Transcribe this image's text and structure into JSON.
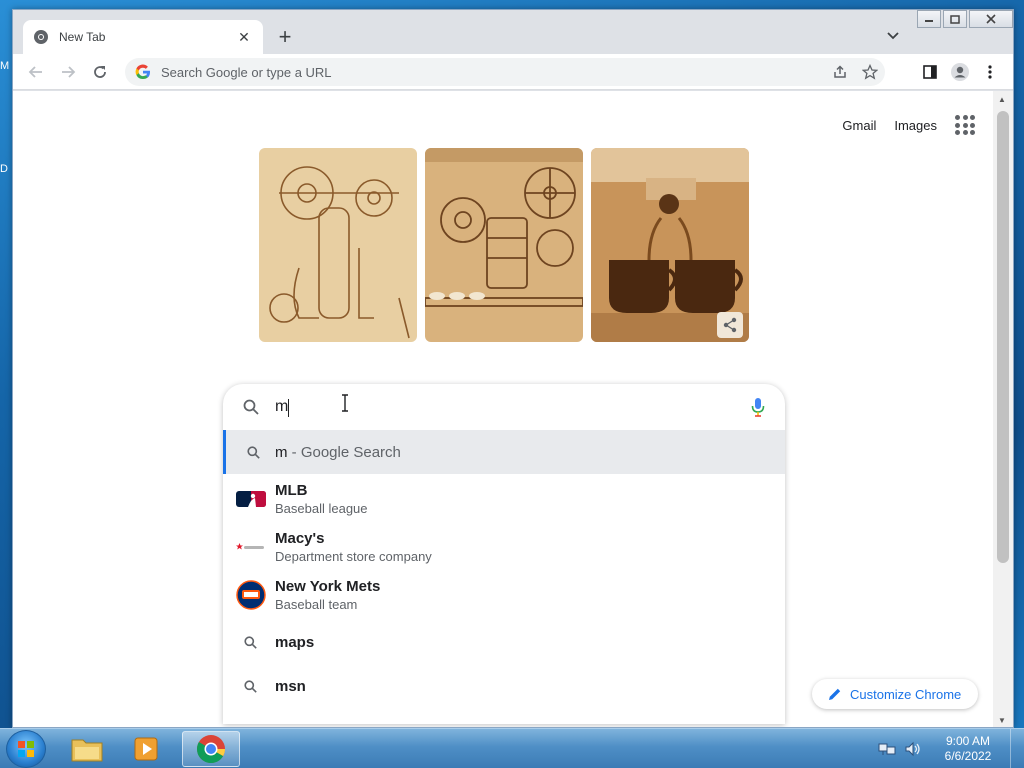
{
  "desktop": {
    "edge_glyphs": [
      "M",
      "D"
    ]
  },
  "browser": {
    "tab": {
      "title": "New Tab"
    },
    "omnibox": {
      "placeholder": "Search Google or type a URL"
    }
  },
  "ntp": {
    "links": {
      "gmail": "Gmail",
      "images": "Images"
    },
    "search": {
      "value": "m"
    },
    "suggestions": [
      {
        "title": "m",
        "suffix": " - Google Search",
        "subtitle": "",
        "icon": "search-icon"
      },
      {
        "title": "MLB",
        "subtitle": "Baseball league",
        "icon": "mlb-logo-icon"
      },
      {
        "title": "Macy's",
        "subtitle": "Department store company",
        "icon": "macys-logo-icon"
      },
      {
        "title": "New York Mets",
        "subtitle": "Baseball team",
        "icon": "mets-logo-icon"
      },
      {
        "title": "maps",
        "subtitle": "",
        "icon": "search-icon"
      },
      {
        "title": "msn",
        "subtitle": "",
        "icon": "search-icon"
      }
    ],
    "customize_label": "Customize Chrome"
  },
  "taskbar": {
    "clock": {
      "time": "9:00 AM",
      "date": "6/6/2022"
    }
  },
  "colors": {
    "accent": "#1a73e8",
    "text_primary": "#202124",
    "text_secondary": "#5f6368",
    "doodle_sepia": "#c79a62"
  }
}
